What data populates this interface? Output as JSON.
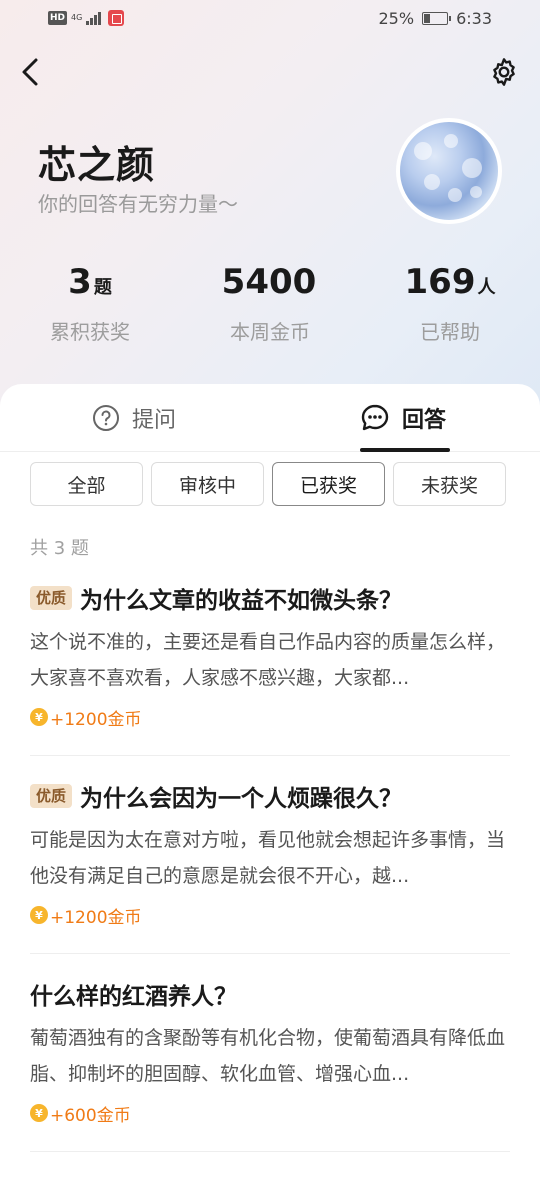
{
  "status_bar": {
    "hd": "HD",
    "network": "4G",
    "battery_text": "25%",
    "battery_level": 0.25,
    "time": "6:33"
  },
  "profile": {
    "name": "芯之颜",
    "motto": "你的回答有无穷力量～"
  },
  "stats": [
    {
      "value": "3",
      "unit": "题",
      "label": "累积获奖"
    },
    {
      "value": "5400",
      "unit": "",
      "label": "本周金币"
    },
    {
      "value": "169",
      "unit": "人",
      "label": "已帮助"
    }
  ],
  "tabs": {
    "ask": "提问",
    "answer": "回答"
  },
  "filters": [
    "全部",
    "审核中",
    "已获奖",
    "未获奖"
  ],
  "active_filter": "已获奖",
  "count_text": "共 3 题",
  "items": [
    {
      "badge": "优质",
      "title": "为什么文章的收益不如微头条？",
      "snippet": "这个说不准的，主要还是看自己作品内容的质量怎么样，大家喜不喜欢看，人家感不感兴趣，大家都...",
      "reward": "+1200金币"
    },
    {
      "badge": "优质",
      "title": "为什么会因为一个人烦躁很久？",
      "snippet": "可能是因为太在意对方啦，看见他就会想起许多事情，当他没有满足自己的意愿是就会很不开心，越...",
      "reward": "+1200金币"
    },
    {
      "badge": "",
      "title": "什么样的红酒养人？",
      "snippet": "葡萄酒独有的含聚酚等有机化合物，使葡萄酒具有降低血脂、抑制坏的胆固醇、软化血管、增强心血...",
      "reward": "+600金币"
    }
  ],
  "coin_glyph": "¥",
  "colors": {
    "accent_orange": "#f07b16",
    "badge_bg": "#f3e0c8",
    "badge_text": "#8a5a2b"
  }
}
